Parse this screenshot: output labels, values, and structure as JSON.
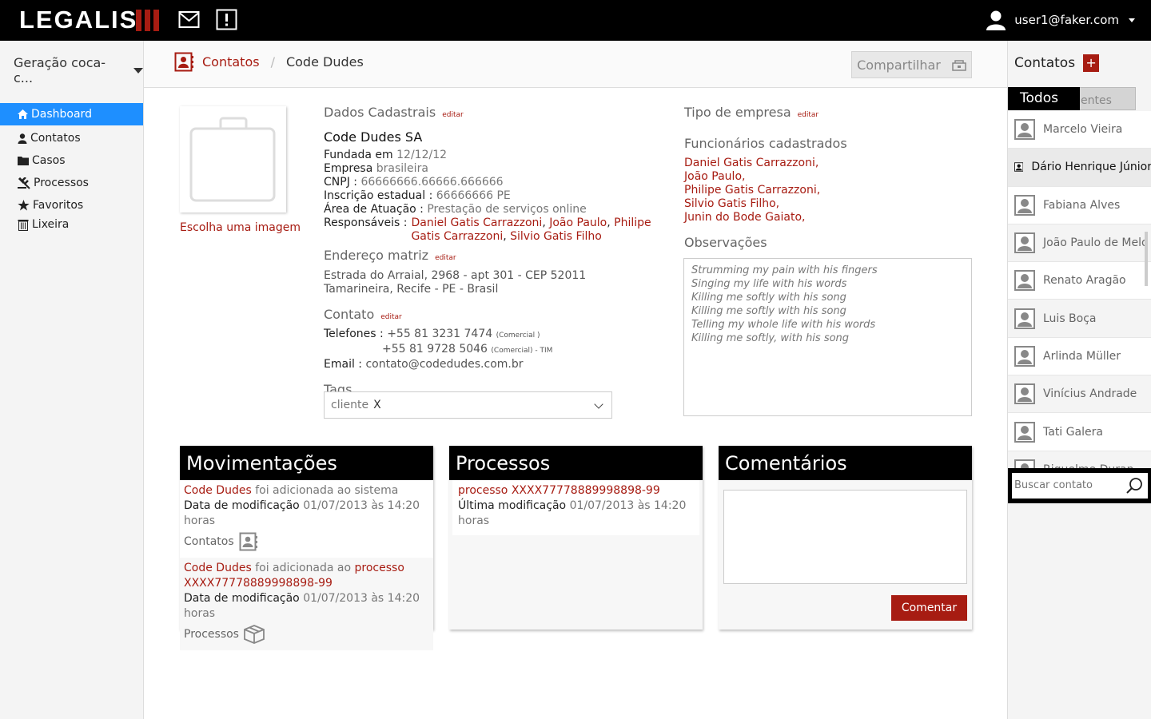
{
  "topbar": {
    "logo": "LEGALIS",
    "user_email": "user1@faker.com",
    "icons": [
      "mail-icon",
      "alert-icon",
      "user-icon"
    ]
  },
  "left": {
    "workspace": "Geração coca-c...",
    "nav": [
      {
        "label": "Dashboard",
        "icon": "home-icon"
      },
      {
        "label": "Contatos",
        "icon": "person-icon"
      },
      {
        "label": "Casos",
        "icon": "folder-icon"
      },
      {
        "label": "Processos",
        "icon": "gavel-icon"
      },
      {
        "label": "Favoritos",
        "icon": "star-icon"
      },
      {
        "label": "Lixeira",
        "icon": "trash-icon"
      }
    ]
  },
  "breadcrumb": {
    "section": "Contatos",
    "current": "Code Dudes"
  },
  "share_label": "Compartilhar",
  "photo": {
    "choose_label": "Escolha uma imagem"
  },
  "dados": {
    "title": "Dados Cadastrais",
    "edit": "editar",
    "name": "Code Dudes SA",
    "fundada_label": "Fundada em",
    "fundada_value": "12/12/12",
    "empresa_label": "Empresa",
    "empresa_value": "brasileira",
    "cnpj_label": "CNPJ :",
    "cnpj_value": "66666666.66666.666666",
    "ie_label": "Inscrição estadual :",
    "ie_value": "66666666 PE",
    "area_label": "Área de Atuação :",
    "area_value": "Prestação de serviços online",
    "resp_label": "Responsáveis :",
    "responsaveis": [
      "Daniel Gatis Carrazzoni",
      "João Paulo",
      "Philipe Gatis Carrazzoni",
      "Silvio Gatis Filho"
    ]
  },
  "endereco": {
    "title": "Endereço matriz",
    "edit": "editar",
    "line1": "Estrada do Arraial, 2968 - apt 301 - CEP 52011",
    "line2": "Tamarineira, Recife - PE - Brasil"
  },
  "contato": {
    "title": "Contato",
    "edit": "editar",
    "tel_label": "Telefones :",
    "tel1": "+55 81 3231 7474",
    "tel1_type": "(Comercial )",
    "tel2": "+55 81 9728 5046",
    "tel2_type": "(Comercial) - TIM",
    "email_label": "Email :",
    "email": "contato@codedudes.com.br"
  },
  "tags": {
    "title": "Tags",
    "items": [
      "cliente"
    ],
    "remove": "X"
  },
  "tipo": {
    "title": "Tipo de empresa",
    "edit": "editar"
  },
  "funcionarios": {
    "title": "Funcionários cadastrados",
    "items": [
      "Daniel Gatis Carrazzoni,",
      "João Paulo,",
      "Philipe Gatis Carrazzoni,",
      "Silvio Gatis Filho,",
      "Junin do Bode Gaiato,"
    ]
  },
  "observacoes": {
    "title": "Observações",
    "lines": [
      "Strumming my pain with his fingers",
      "Singing my life with his words",
      "Killing me softly with his song",
      "Killing me softly with his song",
      "Telling my whole life with his words",
      "Killing me softly, with his song"
    ]
  },
  "movimentacoes": {
    "title": "Movimentações",
    "e1_link": "Code Dudes",
    "e1_text": "foi adicionada ao sistema",
    "date_label": "Data de modificação",
    "date_value": "01/07/2013 às 14:20 horas",
    "e1_type": "Contatos",
    "e2_link": "Code Dudes",
    "e2_text": "foi adicionada ao",
    "e2_link2a": "processo",
    "e2_link2b": "XXXX77778889998898-99",
    "e2_type": "Processos"
  },
  "processos": {
    "title": "Processos",
    "link": "processo XXXX77778889998898-99",
    "mod_label": "Última modificação",
    "mod_value": "01/07/2013 às 14:20 horas"
  },
  "comentarios": {
    "title": "Comentários",
    "button": "Comentar"
  },
  "right": {
    "title": "Contatos",
    "plus": "+",
    "tab_active": "Todos",
    "tab_other": "entes",
    "contacts": [
      "Marcelo Vieira",
      "Dário Henrique Júnior",
      "Fabiana Alves",
      "João Paulo de Melo",
      "Renato Aragão",
      "Luis Boça",
      "Arlinda Müller",
      "Vinícius Andrade",
      "Tati Galera",
      "Riquelme Duran"
    ],
    "search_placeholder": "Buscar contato"
  }
}
